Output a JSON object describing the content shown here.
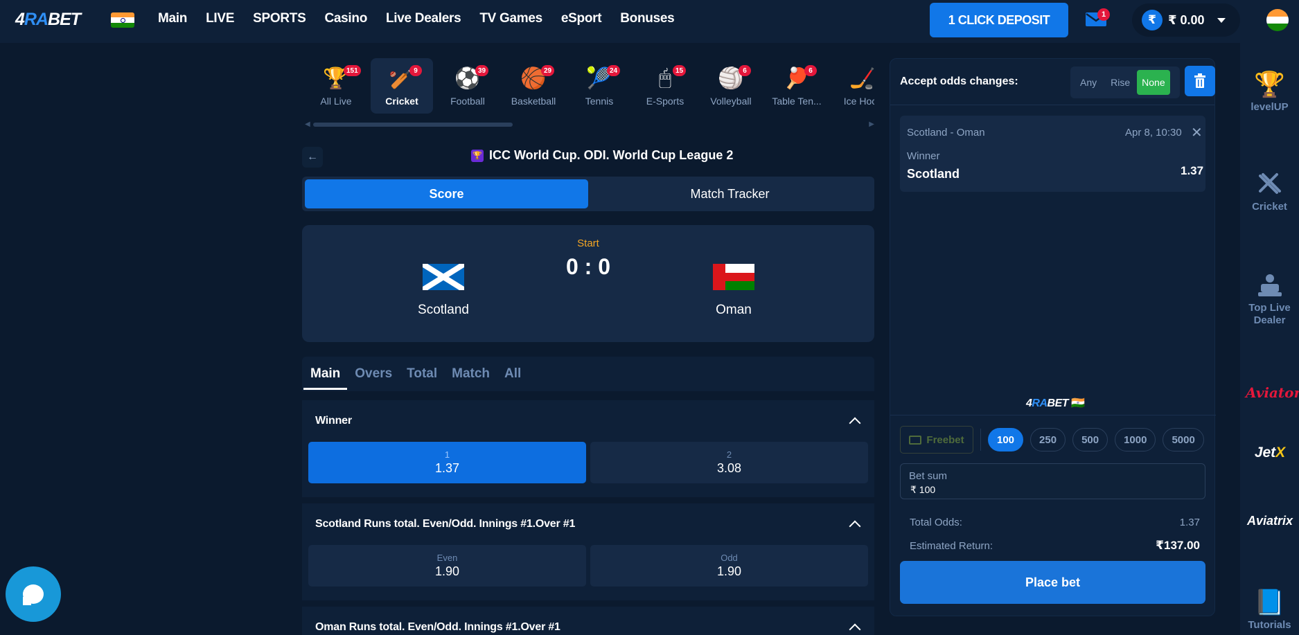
{
  "header": {
    "logo_main": "4",
    "logo_mid": "RA",
    "logo_end": "BET",
    "nav": [
      "Main",
      "LIVE",
      "SPORTS",
      "Casino",
      "Live Dealers",
      "TV Games",
      "eSport",
      "Bonuses"
    ],
    "deposit_label": "1 CLICK DEPOSIT",
    "mail_count": "1",
    "currency_symbol": "₹",
    "balance": "₹ 0.00"
  },
  "sports": [
    {
      "label": "All Live",
      "count": "151",
      "icon": "🏆",
      "active": false
    },
    {
      "label": "Cricket",
      "count": "9",
      "icon": "🏏",
      "active": true
    },
    {
      "label": "Football",
      "count": "39",
      "icon": "⚽",
      "active": false
    },
    {
      "label": "Basketball",
      "count": "29",
      "icon": "🏀",
      "active": false
    },
    {
      "label": "Tennis",
      "count": "24",
      "icon": "🎾",
      "active": false
    },
    {
      "label": "E-Sports",
      "count": "15",
      "icon": "🖱",
      "active": false
    },
    {
      "label": "Volleyball",
      "count": "6",
      "icon": "🏐",
      "active": false
    },
    {
      "label": "Table Ten...",
      "count": "6",
      "icon": "🏓",
      "active": false
    },
    {
      "label": "Ice Hock",
      "count": "",
      "icon": "🏒",
      "active": false
    }
  ],
  "match": {
    "league_icon": "🏆",
    "league": "ICC World Cup. ODI. World Cup League 2",
    "tab_score": "Score",
    "tab_tracker": "Match Tracker",
    "state": "Start",
    "score": "0 : 0",
    "team1": "Scotland",
    "team2": "Oman"
  },
  "market_tabs": [
    "Main",
    "Overs",
    "Total",
    "Match",
    "All"
  ],
  "markets": [
    {
      "title": "Winner",
      "odds": [
        {
          "key": "1",
          "value": "1.37",
          "selected": true
        },
        {
          "key": "2",
          "value": "3.08",
          "selected": false
        }
      ]
    },
    {
      "title": "Scotland Runs total. Even/Odd. Innings #1.Over #1",
      "odds": [
        {
          "key": "Even",
          "value": "1.90",
          "selected": false
        },
        {
          "key": "Odd",
          "value": "1.90",
          "selected": false
        }
      ]
    },
    {
      "title": "Oman Runs total. Even/Odd. Innings #1.Over #1",
      "odds": []
    }
  ],
  "slip": {
    "accept_label": "Accept odds changes:",
    "accept_options": [
      "Any",
      "Rise",
      "None"
    ],
    "accept_selected": "None",
    "bet_teams": "Scotland - Oman",
    "bet_time": "Apr 8, 10:30",
    "bet_market": "Winner",
    "bet_pick": "Scotland",
    "bet_odd": "1.37",
    "logo_main": "4",
    "logo_mid": "RA",
    "logo_end": "BET",
    "freebet": "Freebet",
    "stakes": [
      "100",
      "250",
      "500",
      "1000",
      "5000"
    ],
    "stake_selected": "100",
    "bet_sum_label": "Bet sum",
    "bet_sum_value": "₹  100",
    "total_odds_label": "Total Odds:",
    "total_odds": "1.37",
    "est_return_label": "Estimated Return:",
    "est_return": "₹137.00",
    "place_label": "Place bet"
  },
  "rail": {
    "levelup": "levelUP",
    "cricket": "Cricket",
    "top_live_1": "Top Live",
    "top_live_2": "Dealer",
    "aviator": "Aviator",
    "jetx_a": "Jet",
    "jetx_b": "X",
    "aviatrix": "Aviatrix",
    "tutorials": "Tutorials"
  }
}
